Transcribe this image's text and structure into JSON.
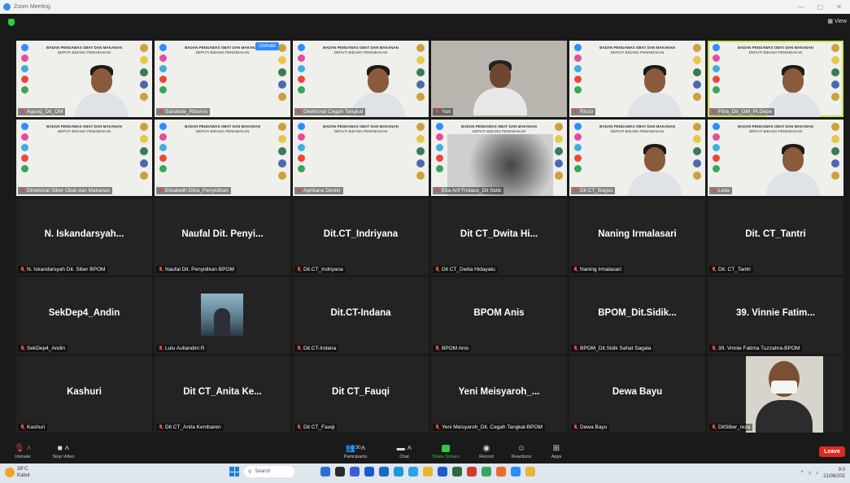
{
  "window": {
    "title": "Zoom Meeting",
    "view_label": "View"
  },
  "slide_header": {
    "line1": "BADAN PENGAWAS OBAT DAN MAKANAN",
    "line2": "DEPUTI BIDANG PENINDAKAN"
  },
  "unmute_pill": "Unmute",
  "video_tiles": [
    {
      "label": "Agung_Dit_OM",
      "kind": "slide-person"
    },
    {
      "label": "Sandede_RitaAris",
      "kind": "slide"
    },
    {
      "label": "Direktorat Cegah Tangkal",
      "kind": "slide-person"
    },
    {
      "label": "Yan",
      "kind": "camera"
    },
    {
      "label": "Ricco",
      "kind": "slide-person"
    },
    {
      "label": "Fitra_Dir_OM_Pt.Depe",
      "kind": "slide-person",
      "active": true
    },
    {
      "label": "Direktorat Siber Obat dan Makanan",
      "kind": "slide"
    },
    {
      "label": "Elisabeth Ditra_Penyidikan",
      "kind": "slide"
    },
    {
      "label": "Apriliana Destin",
      "kind": "slide"
    },
    {
      "label": "Eka Arif Firdaus_Dit Sidik",
      "kind": "slide-blur"
    },
    {
      "label": "Dit CT_Bagus",
      "kind": "slide-person"
    },
    {
      "label": "Leila",
      "kind": "slide-person"
    }
  ],
  "name_tiles": [
    {
      "name": "N. Iskandarsyah...",
      "label": "N. Iskandarsyah Dit. Siber BPOM"
    },
    {
      "name": "Naufal Dit. Penyi...",
      "label": "Naufal Dit. Penyidikan BPOM"
    },
    {
      "name": "Dit.CT_Indriyana",
      "label": "Dit.CT_Indriyana"
    },
    {
      "name": "Dit CT_Dwita Hi...",
      "label": "Dit CT_Dwita Hidayatu"
    },
    {
      "name": "Naning Irmalasari",
      "label": "Naning Irmalasari"
    },
    {
      "name": "Dit. CT_Tantri",
      "label": "Dit. CT_Tantri"
    },
    {
      "name": "SekDep4_Andin",
      "label": "SekDep4_Andin"
    },
    {
      "name": "",
      "label": "Lulu Auliandini R",
      "photo": true
    },
    {
      "name": "Dit.CT-Indana",
      "label": "Dit.CT-Indana"
    },
    {
      "name": "BPOM Anis",
      "label": "BPOM Anis"
    },
    {
      "name": "BPOM_Dit.Sidik...",
      "label": "BPOM_Dit.Sidik Sahat Sagala"
    },
    {
      "name": "39. Vinnie Fatim...",
      "label": "39. Vinnie Fatima Tuzzahra-BPOM"
    },
    {
      "name": "Kashuri",
      "label": "Kashuri"
    },
    {
      "name": "Dit CT_Anita Ke...",
      "label": "Dit CT_Anita Kembaren"
    },
    {
      "name": "Dit CT_Fauqi",
      "label": "Dit CT_Fauqi"
    },
    {
      "name": "Yeni Meisyaroh_...",
      "label": "Yeni Meisyaroh_Dit. Cegah Tangkal-BPOM"
    },
    {
      "name": "Dewa Bayu",
      "label": "Dewa Bayu"
    },
    {
      "name": "",
      "label": "DitSiber_reza",
      "camera": true
    }
  ],
  "toolbar": {
    "unmute": "Unmute",
    "stop_video": "Stop Video",
    "participants": "Participants",
    "participants_count": "30",
    "chat": "Chat",
    "share_screen": "Share Screen",
    "record": "Record",
    "reactions": "Reactions",
    "apps": "Apps",
    "leave": "Leave"
  },
  "taskbar": {
    "temp": "28°C",
    "weather": "Kabut",
    "search": "Search",
    "time": "9:0",
    "date": "21/06/202"
  },
  "colors": {
    "accent": "#2d8cff",
    "share": "#2ecc40",
    "leave": "#e0281f",
    "active_border": "#c7e54a"
  }
}
